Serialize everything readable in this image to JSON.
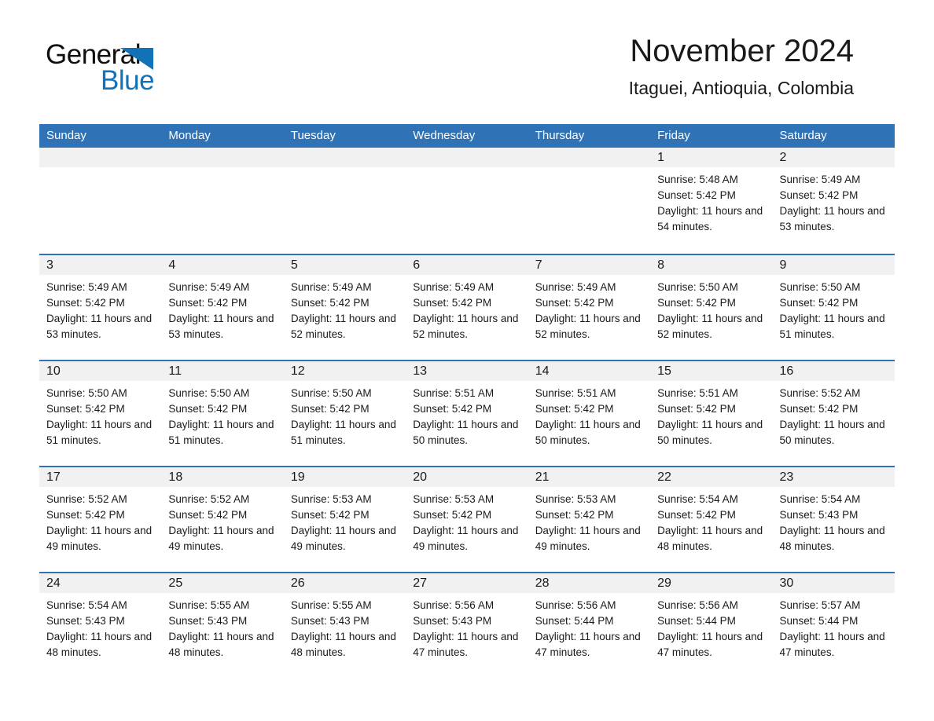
{
  "brand": {
    "name_part1": "General",
    "name_part2": "Blue",
    "triangle_color": "#1272b8"
  },
  "header": {
    "title": "November 2024",
    "location": "Itaguei, Antioquia, Colombia"
  },
  "theme": {
    "header_blue": "#2f72b5",
    "daynum_band": "#f1f1f1",
    "text": "#1a1a1a"
  },
  "calendar": {
    "weekdays": [
      "Sunday",
      "Monday",
      "Tuesday",
      "Wednesday",
      "Thursday",
      "Friday",
      "Saturday"
    ],
    "weeks": [
      [
        {
          "day": "",
          "sunrise": "",
          "sunset": "",
          "daylight": "",
          "empty": true
        },
        {
          "day": "",
          "sunrise": "",
          "sunset": "",
          "daylight": "",
          "empty": true
        },
        {
          "day": "",
          "sunrise": "",
          "sunset": "",
          "daylight": "",
          "empty": true
        },
        {
          "day": "",
          "sunrise": "",
          "sunset": "",
          "daylight": "",
          "empty": true
        },
        {
          "day": "",
          "sunrise": "",
          "sunset": "",
          "daylight": "",
          "empty": true
        },
        {
          "day": "1",
          "sunrise": "Sunrise: 5:48 AM",
          "sunset": "Sunset: 5:42 PM",
          "daylight": "Daylight: 11 hours and 54 minutes.",
          "empty": false
        },
        {
          "day": "2",
          "sunrise": "Sunrise: 5:49 AM",
          "sunset": "Sunset: 5:42 PM",
          "daylight": "Daylight: 11 hours and 53 minutes.",
          "empty": false
        }
      ],
      [
        {
          "day": "3",
          "sunrise": "Sunrise: 5:49 AM",
          "sunset": "Sunset: 5:42 PM",
          "daylight": "Daylight: 11 hours and 53 minutes.",
          "empty": false
        },
        {
          "day": "4",
          "sunrise": "Sunrise: 5:49 AM",
          "sunset": "Sunset: 5:42 PM",
          "daylight": "Daylight: 11 hours and 53 minutes.",
          "empty": false
        },
        {
          "day": "5",
          "sunrise": "Sunrise: 5:49 AM",
          "sunset": "Sunset: 5:42 PM",
          "daylight": "Daylight: 11 hours and 52 minutes.",
          "empty": false
        },
        {
          "day": "6",
          "sunrise": "Sunrise: 5:49 AM",
          "sunset": "Sunset: 5:42 PM",
          "daylight": "Daylight: 11 hours and 52 minutes.",
          "empty": false
        },
        {
          "day": "7",
          "sunrise": "Sunrise: 5:49 AM",
          "sunset": "Sunset: 5:42 PM",
          "daylight": "Daylight: 11 hours and 52 minutes.",
          "empty": false
        },
        {
          "day": "8",
          "sunrise": "Sunrise: 5:50 AM",
          "sunset": "Sunset: 5:42 PM",
          "daylight": "Daylight: 11 hours and 52 minutes.",
          "empty": false
        },
        {
          "day": "9",
          "sunrise": "Sunrise: 5:50 AM",
          "sunset": "Sunset: 5:42 PM",
          "daylight": "Daylight: 11 hours and 51 minutes.",
          "empty": false
        }
      ],
      [
        {
          "day": "10",
          "sunrise": "Sunrise: 5:50 AM",
          "sunset": "Sunset: 5:42 PM",
          "daylight": "Daylight: 11 hours and 51 minutes.",
          "empty": false
        },
        {
          "day": "11",
          "sunrise": "Sunrise: 5:50 AM",
          "sunset": "Sunset: 5:42 PM",
          "daylight": "Daylight: 11 hours and 51 minutes.",
          "empty": false
        },
        {
          "day": "12",
          "sunrise": "Sunrise: 5:50 AM",
          "sunset": "Sunset: 5:42 PM",
          "daylight": "Daylight: 11 hours and 51 minutes.",
          "empty": false
        },
        {
          "day": "13",
          "sunrise": "Sunrise: 5:51 AM",
          "sunset": "Sunset: 5:42 PM",
          "daylight": "Daylight: 11 hours and 50 minutes.",
          "empty": false
        },
        {
          "day": "14",
          "sunrise": "Sunrise: 5:51 AM",
          "sunset": "Sunset: 5:42 PM",
          "daylight": "Daylight: 11 hours and 50 minutes.",
          "empty": false
        },
        {
          "day": "15",
          "sunrise": "Sunrise: 5:51 AM",
          "sunset": "Sunset: 5:42 PM",
          "daylight": "Daylight: 11 hours and 50 minutes.",
          "empty": false
        },
        {
          "day": "16",
          "sunrise": "Sunrise: 5:52 AM",
          "sunset": "Sunset: 5:42 PM",
          "daylight": "Daylight: 11 hours and 50 minutes.",
          "empty": false
        }
      ],
      [
        {
          "day": "17",
          "sunrise": "Sunrise: 5:52 AM",
          "sunset": "Sunset: 5:42 PM",
          "daylight": "Daylight: 11 hours and 49 minutes.",
          "empty": false
        },
        {
          "day": "18",
          "sunrise": "Sunrise: 5:52 AM",
          "sunset": "Sunset: 5:42 PM",
          "daylight": "Daylight: 11 hours and 49 minutes.",
          "empty": false
        },
        {
          "day": "19",
          "sunrise": "Sunrise: 5:53 AM",
          "sunset": "Sunset: 5:42 PM",
          "daylight": "Daylight: 11 hours and 49 minutes.",
          "empty": false
        },
        {
          "day": "20",
          "sunrise": "Sunrise: 5:53 AM",
          "sunset": "Sunset: 5:42 PM",
          "daylight": "Daylight: 11 hours and 49 minutes.",
          "empty": false
        },
        {
          "day": "21",
          "sunrise": "Sunrise: 5:53 AM",
          "sunset": "Sunset: 5:42 PM",
          "daylight": "Daylight: 11 hours and 49 minutes.",
          "empty": false
        },
        {
          "day": "22",
          "sunrise": "Sunrise: 5:54 AM",
          "sunset": "Sunset: 5:42 PM",
          "daylight": "Daylight: 11 hours and 48 minutes.",
          "empty": false
        },
        {
          "day": "23",
          "sunrise": "Sunrise: 5:54 AM",
          "sunset": "Sunset: 5:43 PM",
          "daylight": "Daylight: 11 hours and 48 minutes.",
          "empty": false
        }
      ],
      [
        {
          "day": "24",
          "sunrise": "Sunrise: 5:54 AM",
          "sunset": "Sunset: 5:43 PM",
          "daylight": "Daylight: 11 hours and 48 minutes.",
          "empty": false
        },
        {
          "day": "25",
          "sunrise": "Sunrise: 5:55 AM",
          "sunset": "Sunset: 5:43 PM",
          "daylight": "Daylight: 11 hours and 48 minutes.",
          "empty": false
        },
        {
          "day": "26",
          "sunrise": "Sunrise: 5:55 AM",
          "sunset": "Sunset: 5:43 PM",
          "daylight": "Daylight: 11 hours and 48 minutes.",
          "empty": false
        },
        {
          "day": "27",
          "sunrise": "Sunrise: 5:56 AM",
          "sunset": "Sunset: 5:43 PM",
          "daylight": "Daylight: 11 hours and 47 minutes.",
          "empty": false
        },
        {
          "day": "28",
          "sunrise": "Sunrise: 5:56 AM",
          "sunset": "Sunset: 5:44 PM",
          "daylight": "Daylight: 11 hours and 47 minutes.",
          "empty": false
        },
        {
          "day": "29",
          "sunrise": "Sunrise: 5:56 AM",
          "sunset": "Sunset: 5:44 PM",
          "daylight": "Daylight: 11 hours and 47 minutes.",
          "empty": false
        },
        {
          "day": "30",
          "sunrise": "Sunrise: 5:57 AM",
          "sunset": "Sunset: 5:44 PM",
          "daylight": "Daylight: 11 hours and 47 minutes.",
          "empty": false
        }
      ]
    ]
  }
}
